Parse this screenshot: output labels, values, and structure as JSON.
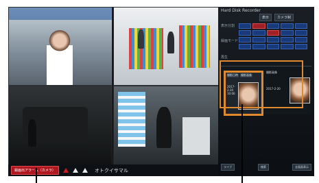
{
  "monitor": {
    "cameras": [
      {
        "id": "cam1",
        "label": ""
      },
      {
        "id": "cam2",
        "label": ""
      },
      {
        "id": "cam3",
        "label": ""
      },
      {
        "id": "cam4",
        "label": ""
      }
    ],
    "bottom_bar": {
      "alarm_button": "録画出アラーム（カメラ）",
      "status_text": "オトクイサマル"
    }
  },
  "panel": {
    "title": "Hard Disk Recorder",
    "tabs": [
      "表示",
      "カメラ制"
    ],
    "side_labels": [
      "表示分割",
      "録画モード",
      "再生"
    ],
    "thumbnails": {
      "left_header": [
        "撮影日時",
        "撮影画像"
      ],
      "left_datetime": "2017-2-20 10:00",
      "right_header": "撮影画像",
      "right_datetime": "2017-2-20"
    },
    "footer_buttons": [
      "ライブ",
      "検索",
      "全画面表示"
    ]
  },
  "colors": {
    "highlight": "#e08a2d",
    "alarm": "#b01820",
    "grid_cell": "#183a7a"
  }
}
